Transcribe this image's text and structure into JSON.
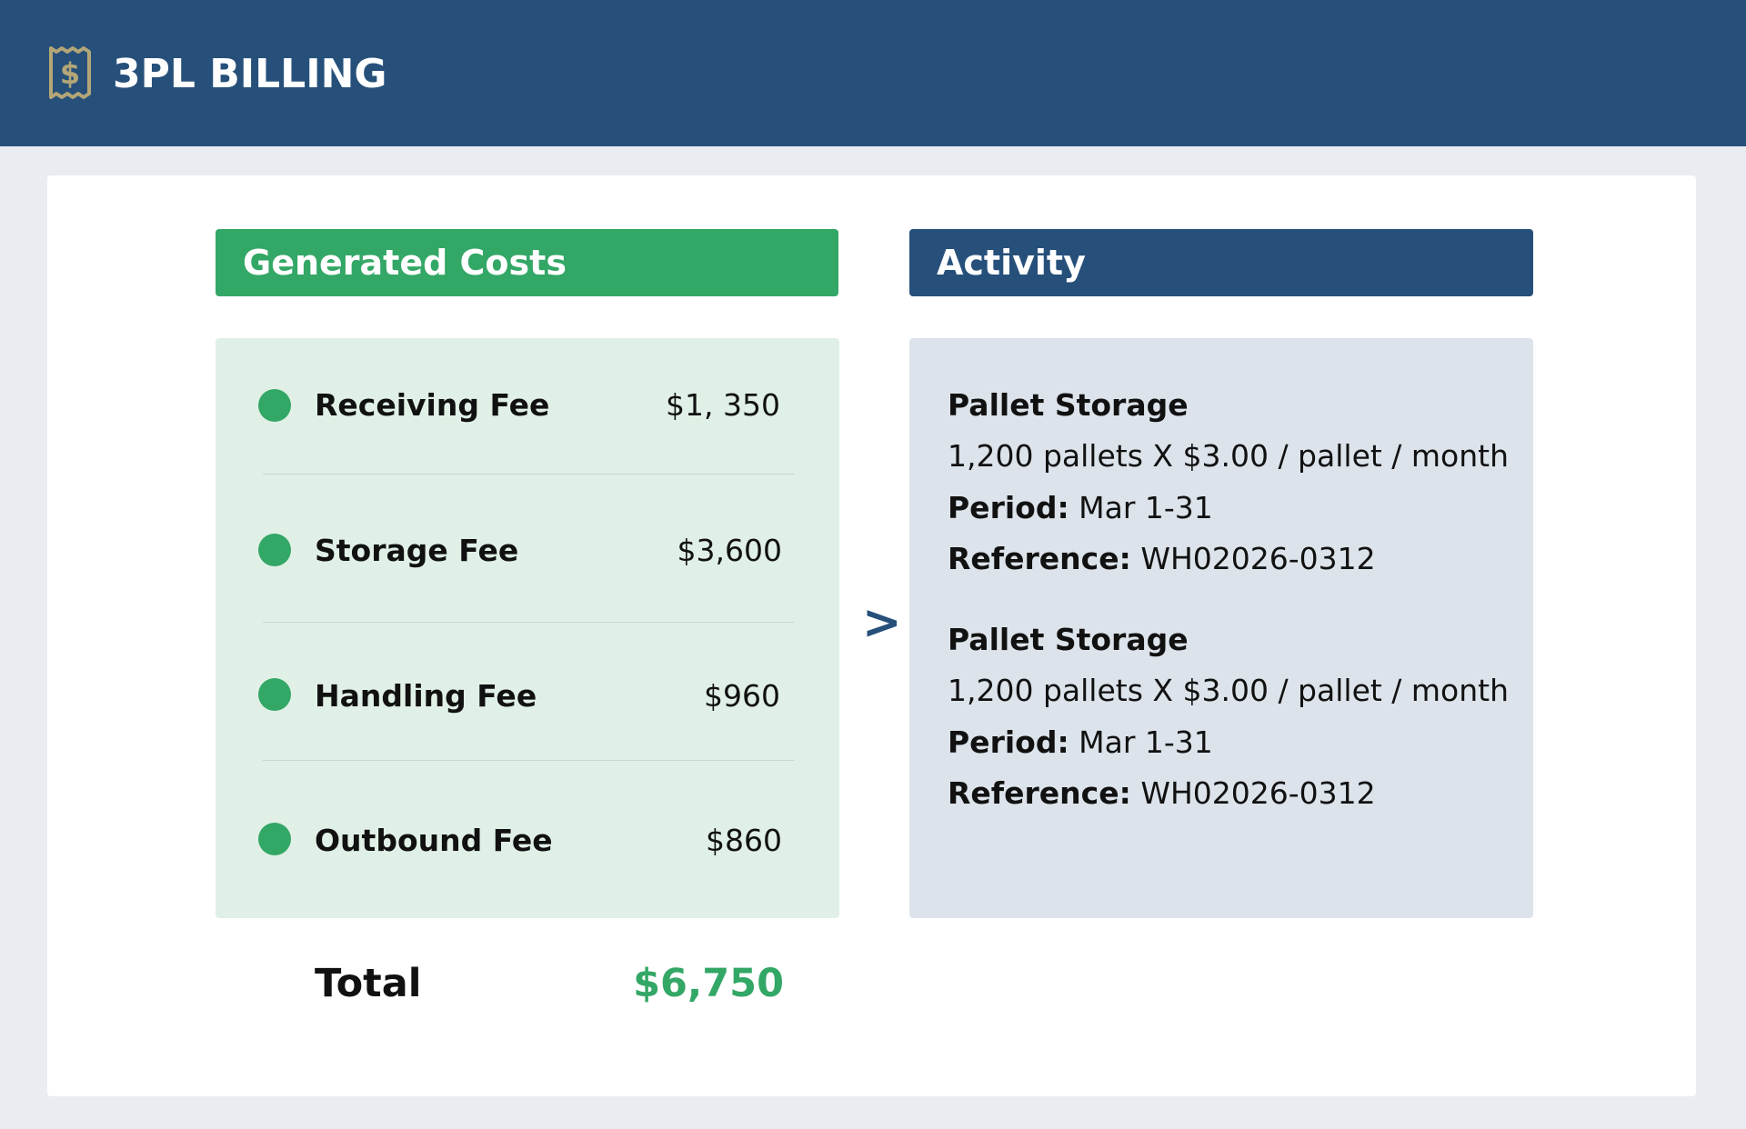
{
  "app": {
    "title": "3PL BILLING",
    "logo_icon": "receipt-dollar-icon"
  },
  "colors": {
    "header": "#26507a",
    "accent_green": "#33a766",
    "logo": "#b3a677"
  },
  "costs": {
    "heading": "Generated Costs",
    "items": [
      {
        "label": "Receiving Fee",
        "amount": "$1, 350"
      },
      {
        "label": "Storage Fee",
        "amount": "$3,600"
      },
      {
        "label": "Handling Fee",
        "amount": "$960"
      },
      {
        "label": "Outbound Fee",
        "amount": "$860"
      }
    ],
    "total_label": "Total",
    "total_value": "$6,750"
  },
  "separator": ">",
  "activity": {
    "heading": "Activity",
    "entries": [
      {
        "title": "Pallet Storage",
        "detail": "1,200 pallets X $3.00 / pallet / month",
        "period_label": "Period:",
        "period_value": "Mar 1-31",
        "reference_label": "Reference:",
        "reference_value": "WH02026-0312"
      },
      {
        "title": "Pallet Storage",
        "detail": "1,200 pallets X $3.00 / pallet / month",
        "period_label": "Period:",
        "period_value": "Mar 1-31",
        "reference_label": "Reference:",
        "reference_value": "WH02026-0312"
      }
    ]
  }
}
